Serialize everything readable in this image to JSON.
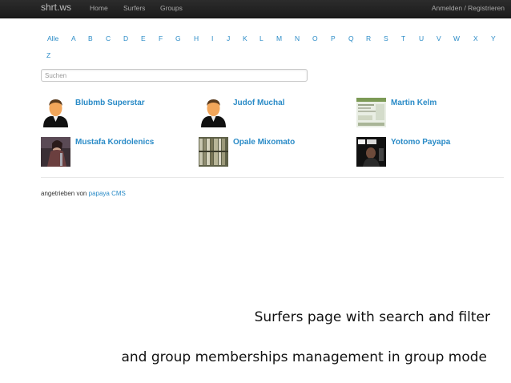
{
  "navbar": {
    "brand": "shrt.ws",
    "links": [
      "Home",
      "Surfers",
      "Groups"
    ],
    "login": "Anmelden / Registrieren"
  },
  "letters": [
    "Alle",
    "A",
    "B",
    "C",
    "D",
    "E",
    "F",
    "G",
    "H",
    "I",
    "J",
    "K",
    "L",
    "M",
    "N",
    "O",
    "P",
    "Q",
    "R",
    "S",
    "T",
    "U",
    "V",
    "W",
    "X",
    "Y",
    "Z"
  ],
  "search": {
    "placeholder": "Suchen",
    "value": ""
  },
  "surfers": [
    {
      "name": "Blubmb Superstar",
      "avatar": "default-user-icon"
    },
    {
      "name": "Judof Muchal",
      "avatar": "default-user-icon"
    },
    {
      "name": "Martin Kelm",
      "avatar": "screenshot-photo"
    },
    {
      "name": "Mustafa Kordolenics",
      "avatar": "warrior-photo"
    },
    {
      "name": "Opale Mixomato",
      "avatar": "bookshelf-photo"
    },
    {
      "name": "Yotomo Payapa",
      "avatar": "poster-photo"
    }
  ],
  "footer": {
    "prefix": "angetrieben von",
    "link": "papaya CMS"
  },
  "captions": [
    "Surfers page with search and filter",
    "and group memberships management in group mode"
  ],
  "colors": {
    "link": "#2a8bc7",
    "navbar": "#1e1e1e"
  }
}
